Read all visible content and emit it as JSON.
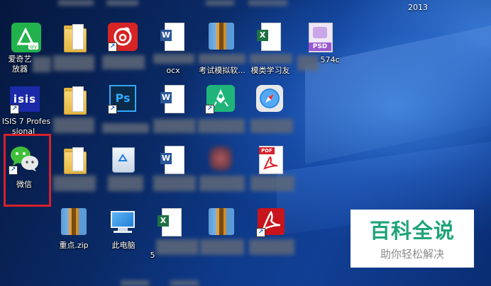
{
  "desktop": {
    "top_right_text": "2013",
    "selected_icon": "wechat",
    "icons": [
      {
        "id": "iqiyi",
        "label_line1": "爱奇艺",
        "label_line2": "放器",
        "icon": "iqiyi-icon"
      },
      {
        "id": "isis",
        "label_line1": "ISIS 7 Profes",
        "label_line2": "sional",
        "icon": "isis-icon",
        "logo_text": "isis"
      },
      {
        "id": "wechat",
        "label": "微信",
        "icon": "wechat-icon"
      },
      {
        "id": "zhongdian-zip",
        "label": "重点.zip",
        "icon": "zip-archive-icon"
      },
      {
        "id": "this-pc",
        "label": "此电脑",
        "icon": "computer-icon"
      },
      {
        "id": "word-row1",
        "label": "ocx",
        "icon": "word-doc-icon",
        "badge": "W"
      },
      {
        "id": "zip-row1",
        "label": "考试模拟软...",
        "icon": "zip-archive-icon"
      },
      {
        "id": "excel-row1",
        "label": "模类学习友",
        "icon": "excel-doc-icon",
        "badge": "X"
      },
      {
        "id": "psd-row1",
        "label": "574c",
        "icon": "psd-file-icon",
        "badge": "PSD"
      },
      {
        "id": "photoshop",
        "icon": "photoshop-icon",
        "badge": "Ps"
      },
      {
        "id": "word-row2",
        "icon": "word-doc-icon",
        "badge": "W"
      },
      {
        "id": "rocket-app",
        "icon": "rocket-app-icon"
      },
      {
        "id": "safari",
        "icon": "compass-icon"
      },
      {
        "id": "recycle-bin",
        "icon": "recycle-bin-icon"
      },
      {
        "id": "word-row3",
        "icon": "word-doc-icon",
        "badge": "W"
      },
      {
        "id": "pdf-file",
        "icon": "pdf-icon",
        "badge": "PDF"
      },
      {
        "id": "excel-row4",
        "label": "5",
        "icon": "excel-doc-icon",
        "badge": "X"
      },
      {
        "id": "zip-row4",
        "icon": "zip-archive-icon"
      },
      {
        "id": "acrobat",
        "icon": "acrobat-icon"
      }
    ]
  },
  "watermark": {
    "title": "百科全说",
    "subtitle": "助你轻松解决"
  },
  "colors": {
    "selection_border": "#d8202a",
    "watermark_green": "#1fa37a",
    "wallpaper_blue": "#0e3a8a"
  }
}
